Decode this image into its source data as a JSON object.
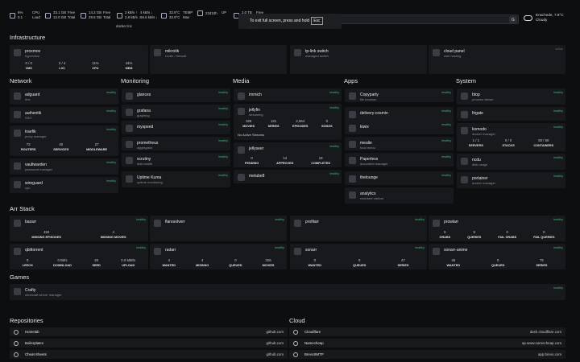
{
  "topbar": {
    "stats": [
      {
        "icon": "cpu-chip-icon",
        "a": "6%",
        "b": "0.1"
      },
      {
        "icon": "none",
        "a": "CPU",
        "b": "Load"
      },
      {
        "icon": "memory-icon",
        "a": "33.1 GB",
        "b": "12.0 GB"
      },
      {
        "icon": "none",
        "a": "Free",
        "b": "Total"
      },
      {
        "icon": "disk-icon",
        "a": "14.2 GB",
        "b": "29.5 GB"
      },
      {
        "icon": "none",
        "a": "Free",
        "b": "Total"
      },
      {
        "icon": "network-icon",
        "a": "2 kB/s ↑",
        "b": "2.8 kB/s ↓"
      },
      {
        "icon": "none",
        "a": "4 kB/s ↓",
        "b": "56.6 kB/s ↓"
      },
      {
        "icon": "thermometer-icon",
        "a": "32.9°C",
        "b": "32.9°C"
      },
      {
        "icon": "none",
        "a": "TEMP",
        "b": "Max"
      },
      {
        "icon": "clock-icon",
        "a": "22d10h",
        "b": ""
      },
      {
        "icon": "none",
        "a": "UP",
        "b": ""
      },
      {
        "icon": "disk-icon",
        "a": "2.0 TB",
        "b": "2.1 TB"
      },
      {
        "icon": "none",
        "a": "Free",
        "b": "Total"
      }
    ],
    "docker_label": "docker lnc",
    "fullscreen_msg": "To exit full screen, press and hold",
    "esc_key": "Esc",
    "search_btn": "G",
    "storage_label": "storage",
    "weather_city": "Enschede, 7.8°C",
    "weather_desc": "Cloudy"
  },
  "sections": {
    "infrastructure": "Infrastructure",
    "network": "Network",
    "monitoring": "Monitoring",
    "media": "Media",
    "apps": "Apps",
    "system": "System",
    "arr": "Arr Stack",
    "games": "Games",
    "repos": "Repositories",
    "cloud": "Cloud"
  },
  "infra": [
    {
      "name": "proxmox",
      "desc": "hypervisor",
      "badge": "",
      "mets": [
        [
          "0 / 0",
          "VMS"
        ],
        [
          "3 / 4",
          "LXC"
        ],
        [
          "11%",
          "CPU"
        ],
        [
          "44%",
          "MEM"
        ]
      ]
    },
    {
      "name": "mikrotik",
      "desc": "router / firewall",
      "badge": ""
    },
    {
      "name": "tp-link switch",
      "desc": "managed switch",
      "badge": ""
    },
    {
      "name": "cloud panel",
      "desc": "web hosting",
      "badge": "online"
    }
  ],
  "network": [
    {
      "name": "adguard",
      "desc": "dns",
      "badge": "healthy"
    },
    {
      "name": "authentik",
      "desc": "SSO",
      "badge": "healthy"
    },
    {
      "name": "traefik",
      "desc": "proxy manager",
      "badge": "healthy",
      "mets": [
        [
          "73",
          "ROUTERS"
        ],
        [
          "40",
          "SERVICES"
        ],
        [
          "27",
          "MIDDLEWARE"
        ]
      ]
    },
    {
      "name": "vaultwarden",
      "desc": "password manager",
      "badge": "healthy"
    },
    {
      "name": "wireguard",
      "desc": "vpn",
      "badge": "healthy"
    }
  ],
  "monitoring": [
    {
      "name": "glances",
      "desc": "",
      "badge": "healthy"
    },
    {
      "name": "grafana",
      "desc": "graphing",
      "badge": "healthy"
    },
    {
      "name": "myspeed",
      "desc": "",
      "badge": "healthy"
    },
    {
      "name": "prometheus",
      "desc": "aggregator",
      "badge": "healthy"
    },
    {
      "name": "scrutiny",
      "desc": "disk health",
      "badge": "healthy"
    },
    {
      "name": "Uptime Kuma",
      "desc": "uptime monitoring",
      "badge": "healthy"
    }
  ],
  "media": [
    {
      "name": "immich",
      "desc": "",
      "badge": "healthy"
    },
    {
      "name": "jellyfin",
      "desc": "streaming",
      "badge": "healthy",
      "mets": [
        [
          "326",
          "MOVIES"
        ],
        [
          "121",
          "SERIES"
        ],
        [
          "2,564",
          "EPISODES"
        ],
        [
          "0",
          "SONGS"
        ]
      ],
      "note": "No Active Streams"
    },
    {
      "name": "jellyseer",
      "desc": "",
      "badge": "healthy",
      "mets": [
        [
          "0",
          "PENDING"
        ],
        [
          "14",
          "APPROVED"
        ],
        [
          "19",
          "COMPLETED"
        ]
      ]
    },
    {
      "name": "metube8",
      "desc": "",
      "badge": "healthy"
    }
  ],
  "apps": [
    {
      "name": "Copyparty",
      "desc": "file browser",
      "badge": "healthy"
    },
    {
      "name": "delivery-cosmin",
      "desc": "",
      "badge": "healthy"
    },
    {
      "name": "kiwix",
      "desc": "",
      "badge": "healthy"
    },
    {
      "name": "mealie",
      "desc": "food menu",
      "badge": "healthy"
    },
    {
      "name": "Paperless",
      "desc": "document manager",
      "badge": "healthy"
    },
    {
      "name": "thelounge",
      "desc": "",
      "badge": "healthy"
    },
    {
      "name": "analytics",
      "desc": "real-time visitors",
      "badge": ""
    }
  ],
  "system": [
    {
      "name": "btop",
      "desc": "process viewer",
      "badge": "healthy"
    },
    {
      "name": "frigate",
      "desc": "",
      "badge": "healthy"
    },
    {
      "name": "komodo",
      "desc": "docker manager",
      "badge": "healthy",
      "mets": [
        [
          "1 / 1",
          "SERVERS"
        ],
        [
          "0 / 0",
          "STACKS"
        ],
        [
          "50 / 50",
          "CONTAINERS"
        ]
      ]
    },
    {
      "name": "ncdu",
      "desc": "disk usage",
      "badge": "healthy"
    },
    {
      "name": "portainer",
      "desc": "docker manager",
      "badge": "healthy"
    }
  ],
  "arr": [
    {
      "name": "bazarr",
      "badge": "healthy",
      "mets": [
        [
          "450",
          "MISSING EPISODES"
        ],
        [
          "4",
          "MISSING MOVIES"
        ]
      ]
    },
    {
      "name": "flaresolverr",
      "badge": "healthy"
    },
    {
      "name": "profilarr",
      "badge": "healthy"
    },
    {
      "name": "prowlarr",
      "badge": "healthy",
      "mets": [
        [
          "5",
          "GRABS"
        ],
        [
          "9",
          "QUERIES"
        ],
        [
          "0",
          "FAIL GRABS"
        ],
        [
          "0",
          "FAIL QUERIES"
        ]
      ]
    },
    {
      "name": "qbittorrent",
      "badge": "healthy",
      "mets": [
        [
          "0",
          "LEECH"
        ],
        [
          "0 Bit/s",
          "DOWNLOAD"
        ],
        [
          "45",
          "SEED"
        ],
        [
          "0.0 MiB/s",
          "UPLOAD"
        ]
      ]
    },
    {
      "name": "radarr",
      "badge": "healthy",
      "mets": [
        [
          "4",
          "WANTED"
        ],
        [
          "4",
          "MISSING"
        ],
        [
          "0",
          "QUEUED"
        ],
        [
          "326",
          "MOVIES"
        ]
      ]
    },
    {
      "name": "sonarr",
      "badge": "healthy",
      "mets": [
        [
          "0",
          "WANTED"
        ],
        [
          "0",
          "QUEUED"
        ],
        [
          "47",
          "SERIES"
        ]
      ]
    },
    {
      "name": "sonarr-anime",
      "badge": "healthy",
      "mets": [
        [
          "46",
          "WANTED"
        ],
        [
          "0",
          "QUEUED"
        ],
        [
          "75",
          "SERIES"
        ]
      ]
    }
  ],
  "games": [
    {
      "name": "Crafty",
      "desc": "minecraft server manager",
      "badge": "healthy"
    }
  ],
  "repos": [
    {
      "name": "Homelab",
      "url": "github.com"
    },
    {
      "name": "Boilerplates",
      "url": "github.com"
    },
    {
      "name": "Cheat-Sheets",
      "url": "github.com"
    }
  ],
  "cloud": [
    {
      "name": "Cloudflare",
      "url": "dash.cloudflare.com"
    },
    {
      "name": "Namecheap",
      "url": "ap.www.namecheap.com"
    },
    {
      "name": "BrevoSMTP",
      "url": "app.brevo.com"
    }
  ]
}
